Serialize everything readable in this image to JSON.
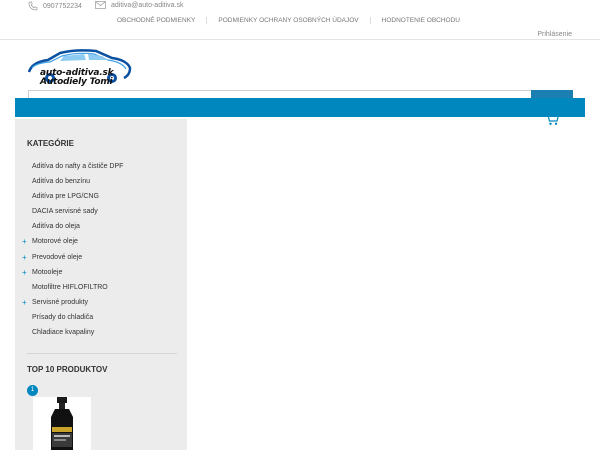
{
  "header": {
    "phone": "0907752234",
    "email": "aditiva@auto-aditiva.sk",
    "links": [
      "OBCHODNÉ PODMIENKY",
      "PODMIENKY OCHRANY OSOBNÝCH ÚDAJOV",
      "HODNOTENIE OBCHODU"
    ],
    "login": "Prihlásenie"
  },
  "logo": {
    "line1": "auto-aditiva.sk",
    "line2": "Autodiely Tomi"
  },
  "colors": {
    "accent": "#0087be",
    "sidebar_bg": "#ececec"
  },
  "sidebar": {
    "categories_title": "KATEGÓRIE",
    "categories": [
      {
        "label": "Aditíva do nafty a čističe DPF",
        "expandable": false
      },
      {
        "label": "Aditíva do benzínu",
        "expandable": false
      },
      {
        "label": "Aditíva pre LPG/CNG",
        "expandable": false
      },
      {
        "label": "DACIA servisné sady",
        "expandable": false
      },
      {
        "label": "Aditíva do oleja",
        "expandable": false
      },
      {
        "label": "Motorové oleje",
        "expandable": true
      },
      {
        "label": "Prevodové oleje",
        "expandable": true
      },
      {
        "label": "Motooleje",
        "expandable": true
      },
      {
        "label": "Motofiltre HIFLOFILTRO",
        "expandable": false
      },
      {
        "label": "Servisné produkty",
        "expandable": true
      },
      {
        "label": "Prísady do chladiča",
        "expandable": false
      },
      {
        "label": "Chladiace kvapaliny",
        "expandable": false
      }
    ],
    "top_title": "TOP 10 PRODUKTOV",
    "top_rank": "1"
  },
  "icons": {
    "phone": "phone-icon",
    "mail": "mail-icon",
    "cart": "cart-icon",
    "plus": "plus-icon"
  }
}
